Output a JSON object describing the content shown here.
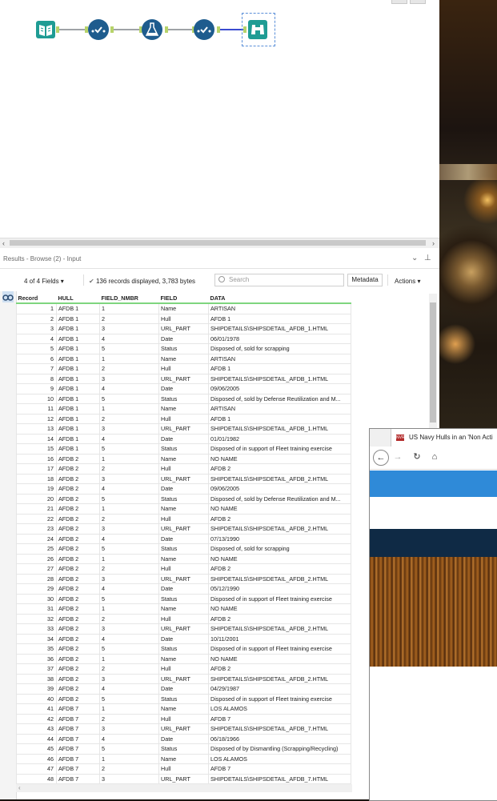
{
  "workflow": {
    "tools": [
      "input-data-icon",
      "select-icon",
      "formula-icon",
      "select-icon",
      "browse-icon"
    ]
  },
  "results": {
    "title": "Results - Browse (2) - Input",
    "fields_selector": "4 of 4 Fields",
    "records_displayed": "136 records displayed, 3,783 bytes",
    "search_placeholder": "Search",
    "metadata_label": "Metadata",
    "actions_label": "Actions"
  },
  "table": {
    "headers": [
      "Record",
      "HULL",
      "FIELD_NMBR",
      "FIELD",
      "DATA"
    ],
    "rows": [
      [
        "1",
        "AFDB 1",
        "1",
        "Name",
        "ARTISAN"
      ],
      [
        "2",
        "AFDB 1",
        "2",
        "Hull",
        "AFDB 1"
      ],
      [
        "3",
        "AFDB 1",
        "3",
        "URL_PART",
        "SHIPDETAILS\\SHIPSDETAIL_AFDB_1.HTML"
      ],
      [
        "4",
        "AFDB 1",
        "4",
        "Date",
        "06/01/1978"
      ],
      [
        "5",
        "AFDB 1",
        "5",
        "Status",
        "Disposed of, sold for scrapping"
      ],
      [
        "6",
        "AFDB 1",
        "1",
        "Name",
        "ARTISAN"
      ],
      [
        "7",
        "AFDB 1",
        "2",
        "Hull",
        "AFDB 1"
      ],
      [
        "8",
        "AFDB 1",
        "3",
        "URL_PART",
        "SHIPDETAILS\\SHIPSDETAIL_AFDB_1.HTML"
      ],
      [
        "9",
        "AFDB 1",
        "4",
        "Date",
        "09/06/2005"
      ],
      [
        "10",
        "AFDB 1",
        "5",
        "Status",
        "Disposed of, sold by Defense Reutilization and M..."
      ],
      [
        "11",
        "AFDB 1",
        "1",
        "Name",
        "ARTISAN"
      ],
      [
        "12",
        "AFDB 1",
        "2",
        "Hull",
        "AFDB 1"
      ],
      [
        "13",
        "AFDB 1",
        "3",
        "URL_PART",
        "SHIPDETAILS\\SHIPSDETAIL_AFDB_1.HTML"
      ],
      [
        "14",
        "AFDB 1",
        "4",
        "Date",
        "01/01/1982"
      ],
      [
        "15",
        "AFDB 1",
        "5",
        "Status",
        "Disposed of in support of Fleet training exercise"
      ],
      [
        "16",
        "AFDB 2",
        "1",
        "Name",
        "NO NAME"
      ],
      [
        "17",
        "AFDB 2",
        "2",
        "Hull",
        "AFDB 2"
      ],
      [
        "18",
        "AFDB 2",
        "3",
        "URL_PART",
        "SHIPDETAILS\\SHIPSDETAIL_AFDB_2.HTML"
      ],
      [
        "19",
        "AFDB 2",
        "4",
        "Date",
        "09/06/2005"
      ],
      [
        "20",
        "AFDB 2",
        "5",
        "Status",
        "Disposed of, sold by Defense Reutilization and M..."
      ],
      [
        "21",
        "AFDB 2",
        "1",
        "Name",
        "NO NAME"
      ],
      [
        "22",
        "AFDB 2",
        "2",
        "Hull",
        "AFDB 2"
      ],
      [
        "23",
        "AFDB 2",
        "3",
        "URL_PART",
        "SHIPDETAILS\\SHIPSDETAIL_AFDB_2.HTML"
      ],
      [
        "24",
        "AFDB 2",
        "4",
        "Date",
        "07/13/1990"
      ],
      [
        "25",
        "AFDB 2",
        "5",
        "Status",
        "Disposed of, sold for scrapping"
      ],
      [
        "26",
        "AFDB 2",
        "1",
        "Name",
        "NO NAME"
      ],
      [
        "27",
        "AFDB 2",
        "2",
        "Hull",
        "AFDB 2"
      ],
      [
        "28",
        "AFDB 2",
        "3",
        "URL_PART",
        "SHIPDETAILS\\SHIPSDETAIL_AFDB_2.HTML"
      ],
      [
        "29",
        "AFDB 2",
        "4",
        "Date",
        "05/12/1990"
      ],
      [
        "30",
        "AFDB 2",
        "5",
        "Status",
        "Disposed of in support of Fleet training exercise"
      ],
      [
        "31",
        "AFDB 2",
        "1",
        "Name",
        "NO NAME"
      ],
      [
        "32",
        "AFDB 2",
        "2",
        "Hull",
        "AFDB 2"
      ],
      [
        "33",
        "AFDB 2",
        "3",
        "URL_PART",
        "SHIPDETAILS\\SHIPSDETAIL_AFDB_2.HTML"
      ],
      [
        "34",
        "AFDB 2",
        "4",
        "Date",
        "10/11/2001"
      ],
      [
        "35",
        "AFDB 2",
        "5",
        "Status",
        "Disposed of in support of Fleet training exercise"
      ],
      [
        "36",
        "AFDB 2",
        "1",
        "Name",
        "NO NAME"
      ],
      [
        "37",
        "AFDB 2",
        "2",
        "Hull",
        "AFDB 2"
      ],
      [
        "38",
        "AFDB 2",
        "3",
        "URL_PART",
        "SHIPDETAILS\\SHIPSDETAIL_AFDB_2.HTML"
      ],
      [
        "39",
        "AFDB 2",
        "4",
        "Date",
        "04/29/1987"
      ],
      [
        "40",
        "AFDB 2",
        "5",
        "Status",
        "Disposed of in support of Fleet training exercise"
      ],
      [
        "41",
        "AFDB 7",
        "1",
        "Name",
        "LOS ALAMOS"
      ],
      [
        "42",
        "AFDB 7",
        "2",
        "Hull",
        "AFDB 7"
      ],
      [
        "43",
        "AFDB 7",
        "3",
        "URL_PART",
        "SHIPDETAILS\\SHIPSDETAIL_AFDB_7.HTML"
      ],
      [
        "44",
        "AFDB 7",
        "4",
        "Date",
        "06/18/1966"
      ],
      [
        "45",
        "AFDB 7",
        "5",
        "Status",
        "Disposed of by Dismantling (Scrapping/Recycling)"
      ],
      [
        "46",
        "AFDB 7",
        "1",
        "Name",
        "LOS ALAMOS"
      ],
      [
        "47",
        "AFDB 7",
        "2",
        "Hull",
        "AFDB 7"
      ],
      [
        "48",
        "AFDB 7",
        "3",
        "URL_PART",
        "SHIPDETAILS\\SHIPSDETAIL_AFDB_7.HTML"
      ]
    ]
  },
  "browser": {
    "tab_title": "US Navy Hulls in an 'Non Acti",
    "favicon_text": "NVR"
  },
  "colors": {
    "tool_blue": "#1e5c8e",
    "input_teal": "#1f9c94",
    "header_green": "#7fd67f",
    "browser_blue": "#2f8ad8",
    "browser_navy": "#0f2a45"
  }
}
